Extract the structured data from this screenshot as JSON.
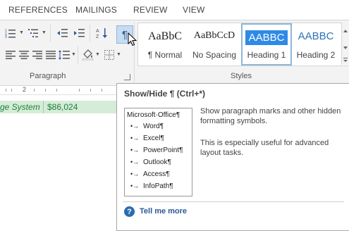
{
  "tabs": [
    {
      "label": "REFERENCES"
    },
    {
      "label": "MAILINGS"
    },
    {
      "label": "REVIEW"
    },
    {
      "label": "VIEW"
    }
  ],
  "ribbon": {
    "paragraph_group_label": "Paragraph",
    "styles_group_label": "Styles",
    "pilcrow_glyph": "¶"
  },
  "styles": [
    {
      "sample": "AaBbC",
      "name": "¶ Normal"
    },
    {
      "sample": "AaBbCcD",
      "name": "No Spacing"
    },
    {
      "sample": "AABBC",
      "name": "Heading 1"
    },
    {
      "sample": "AABBC",
      "name": "Heading 2"
    }
  ],
  "ruler": {
    "mark": "2"
  },
  "document": {
    "cell1": "ge System",
    "cell2": "$86,024"
  },
  "tooltip": {
    "title": "Show/Hide ¶ (Ctrl+*)",
    "figure": {
      "root": "Microsoft·Office¶",
      "items": [
        "Word¶",
        "Excel¶",
        "PowerPoint¶",
        "Outlook¶",
        "Access¶",
        "InfoPath¶"
      ]
    },
    "description_1": "Show paragraph marks and other hidden formatting symbols.",
    "description_2": "This is especially useful for advanced layout tasks.",
    "help_link": "Tell me more"
  },
  "colors": {
    "accent": "#2b579a",
    "selected_style": "#2e8ae6",
    "doc_highlight": "#d5ecd9",
    "doc_text": "#1f7f38"
  }
}
